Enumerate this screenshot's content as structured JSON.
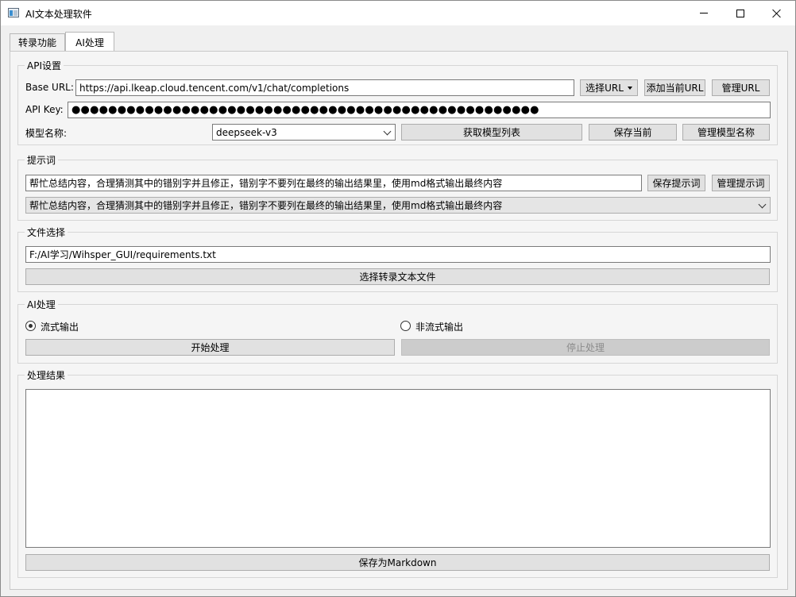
{
  "window": {
    "title": "AI文本处理软件"
  },
  "tabs": [
    {
      "label": "转录功能"
    },
    {
      "label": "AI处理"
    }
  ],
  "api_settings": {
    "title": "API设置",
    "base_url_label": "Base URL:",
    "base_url_value": "https://api.lkeap.cloud.tencent.com/v1/chat/completions",
    "select_url_label": "选择URL",
    "add_url_label": "添加当前URL",
    "manage_url_label": "管理URL",
    "api_key_label": "API Key:",
    "api_key_value": "●●●●●●●●●●●●●●●●●●●●●●●●●●●●●●●●●●●●●●●●●●●●●●●●●●●",
    "model_label": "模型名称:",
    "model_value": "deepseek-v3",
    "fetch_models_label": "获取模型列表",
    "save_current_label": "保存当前",
    "manage_models_label": "管理模型名称"
  },
  "prompt": {
    "title": "提示词",
    "prompt_value": "帮忙总结内容，合理猜测其中的错别字并且修正，错别字不要列在最终的输出结果里，使用md格式输出最终内容",
    "save_prompt_label": "保存提示词",
    "manage_prompt_label": "管理提示词",
    "prompt_select_value": "帮忙总结内容，合理猜测其中的错别字并且修正，错别字不要列在最终的输出结果里，使用md格式输出最终内容"
  },
  "file_select": {
    "title": "文件选择",
    "path_value": "F:/AI学习/Wihsper_GUI/requirements.txt",
    "select_button_label": "选择转录文本文件"
  },
  "ai_process": {
    "title": "AI处理",
    "stream_label": "流式输出",
    "non_stream_label": "非流式输出",
    "start_label": "开始处理",
    "stop_label": "停止处理"
  },
  "result": {
    "title": "处理结果",
    "content": "",
    "save_markdown_label": "保存为Markdown"
  }
}
